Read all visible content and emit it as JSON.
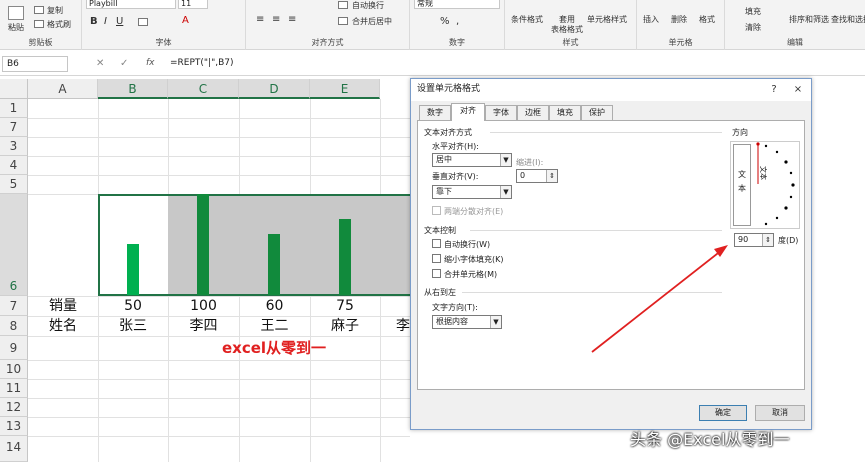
{
  "ribbon": {
    "clipboard": {
      "paste": "粘贴",
      "copy": "复制",
      "format_painter": "格式刷",
      "group": "剪贴板"
    },
    "font": {
      "name": "Playbill",
      "size": "11",
      "group": "字体"
    },
    "alignment": {
      "wrap": "自动换行",
      "merge": "合并后居中",
      "group": "对齐方式"
    },
    "number": {
      "format": "常规",
      "percent": "%",
      "comma": ",",
      "group": "数字"
    },
    "styles": {
      "conditional": "条件格式",
      "table": "套用",
      "table2": "表格格式",
      "cell": "单元格样式",
      "group": "样式"
    },
    "cells": {
      "insert": "插入",
      "delete": "删除",
      "format": "格式",
      "group": "单元格"
    },
    "editing": {
      "fill": "填充",
      "clear": "清除",
      "sort": "排序和筛选",
      "find": "查找和选择",
      "group": "编辑"
    }
  },
  "formula_bar": {
    "name_box": "B6",
    "fx": "fx",
    "formula": "=REPT(\"|\",B7)"
  },
  "sheet": {
    "columns": [
      "A",
      "B",
      "C",
      "D",
      "E"
    ],
    "row_numbers": [
      "1",
      "7",
      "3",
      "4",
      "5",
      "6",
      "7",
      "8",
      "9",
      "10",
      "11",
      "12",
      "13",
      "14"
    ],
    "row7": {
      "label": "销量",
      "values": [
        "50",
        "100",
        "60",
        "75"
      ]
    },
    "row8": {
      "label": "姓名",
      "names": [
        "张三",
        "李四",
        "王二",
        "麻子",
        "李"
      ]
    },
    "title": "excel从零到一",
    "bar_values": [
      50,
      100,
      60,
      75
    ],
    "bar_colors": [
      "#00b050",
      "#118a3c",
      "#118a3c",
      "#118a3c"
    ]
  },
  "dialog": {
    "title": "设置单元格格式",
    "help": "?",
    "close": "×",
    "tabs": [
      "数字",
      "对齐",
      "字体",
      "边框",
      "填充",
      "保护"
    ],
    "active_tab": "对齐",
    "text_alignment": "文本对齐方式",
    "horizontal_label": "水平对齐(H):",
    "horizontal_value": "居中",
    "indent_label": "缩进(I):",
    "indent_value": "0",
    "vertical_label": "垂直对齐(V):",
    "vertical_value": "靠下",
    "justify_distributed": "两端分散对齐(E)",
    "text_control": "文本控制",
    "wrap_text": "自动换行(W)",
    "shrink": "缩小字体填充(K)",
    "merge": "合并单元格(M)",
    "rtl": "从右到左",
    "direction_label": "文字方向(T):",
    "direction_value": "根据内容",
    "orientation": "方向",
    "vertical_text": [
      "文",
      "本"
    ],
    "orientation_text": "文本",
    "degrees_value": "90",
    "degrees_label": "度(D)",
    "ok": "确定",
    "cancel": "取消"
  },
  "watermark": "头条 @Excel从零到一"
}
